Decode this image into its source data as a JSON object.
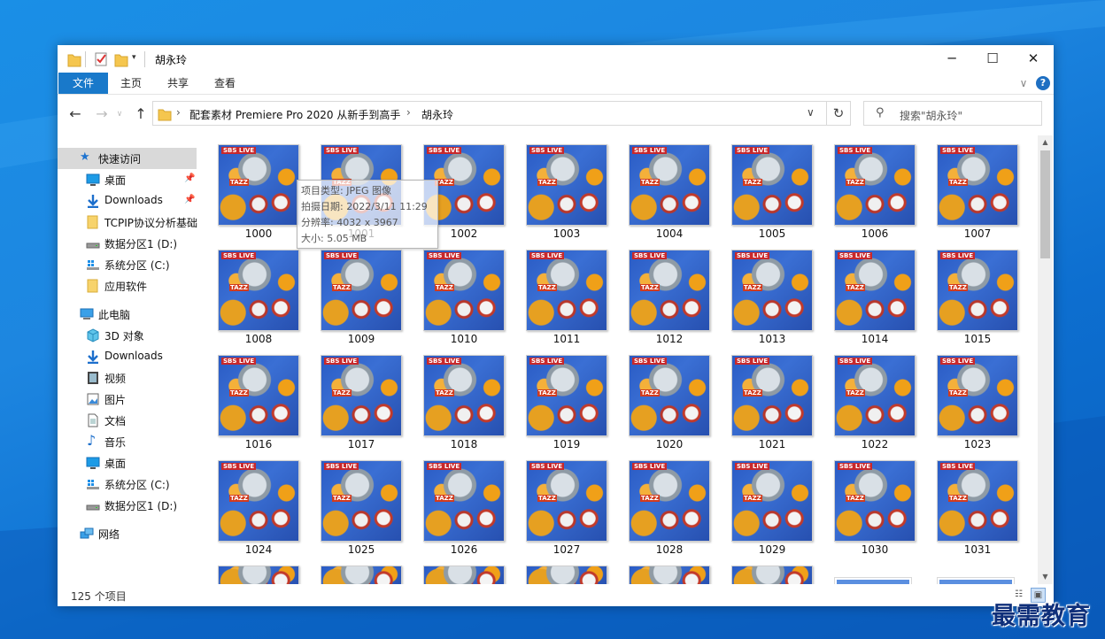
{
  "window": {
    "title": "胡永玲",
    "controls": {
      "minimize": "─",
      "maximize": "☐",
      "close": "✕"
    }
  },
  "ribbon": {
    "tabs": [
      "文件",
      "主页",
      "共享",
      "查看"
    ],
    "expand_glyph": "∨",
    "help_glyph": "?"
  },
  "address": {
    "back": "←",
    "forward": "→",
    "up": "↑",
    "segments": [
      "配套素材 Premiere Pro 2020 从新手到高手",
      "胡永玲"
    ],
    "separator": "›",
    "dropdown": "∨",
    "refresh": "↻"
  },
  "search": {
    "placeholder": "搜索\"胡永玲\"",
    "icon": "search-icon"
  },
  "nav": {
    "quick_access": "快速访问",
    "quick_items": [
      {
        "label": "桌面",
        "icon": "desktop-icon",
        "pinned": true
      },
      {
        "label": "Downloads",
        "icon": "download-icon",
        "pinned": true
      },
      {
        "label": "TCPIP协议分析基础",
        "icon": "folder-icon",
        "pinned": false
      },
      {
        "label": "数据分区1 (D:)",
        "icon": "drive-icon",
        "pinned": false
      },
      {
        "label": "系统分区 (C:)",
        "icon": "windows-drive-icon",
        "pinned": false
      },
      {
        "label": "应用软件",
        "icon": "folder-icon",
        "pinned": false
      }
    ],
    "this_pc": "此电脑",
    "pc_items": [
      {
        "label": "3D 对象",
        "icon": "3d-objects-icon"
      },
      {
        "label": "Downloads",
        "icon": "download-icon"
      },
      {
        "label": "视频",
        "icon": "video-icon"
      },
      {
        "label": "图片",
        "icon": "pictures-icon"
      },
      {
        "label": "文档",
        "icon": "documents-icon"
      },
      {
        "label": "音乐",
        "icon": "music-icon"
      },
      {
        "label": "桌面",
        "icon": "desktop-icon"
      },
      {
        "label": "系统分区 (C:)",
        "icon": "windows-drive-icon"
      },
      {
        "label": "数据分区1 (D:)",
        "icon": "drive-icon"
      }
    ],
    "network": "网络"
  },
  "files": [
    "1000",
    "1001",
    "1002",
    "1003",
    "1004",
    "1005",
    "1006",
    "1007",
    "1008",
    "1009",
    "1010",
    "1011",
    "1012",
    "1013",
    "1014",
    "1015",
    "1016",
    "1017",
    "1018",
    "1019",
    "1020",
    "1021",
    "1022",
    "1023",
    "1024",
    "1025",
    "1026",
    "1027",
    "1028",
    "1029",
    "1030",
    "1031"
  ],
  "thumb_text": {
    "top": "SBS LIVE",
    "middle": "TAZZ"
  },
  "tooltip": {
    "type": "项目类型: JPEG 图像",
    "date": "拍摄日期: 2022/3/11 11:29",
    "resolution": "分辨率: 4032 x 3967",
    "size": "大小: 5.05 MB"
  },
  "status": {
    "count": "125 个项目"
  },
  "watermark": "最需教育"
}
